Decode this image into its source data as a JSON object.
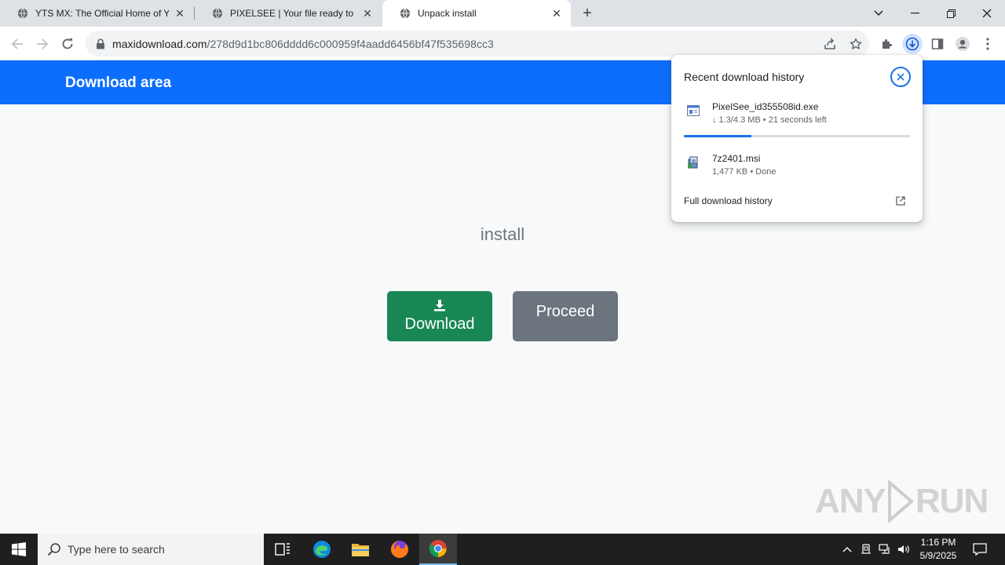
{
  "browser": {
    "tabs": [
      {
        "title": "YTS MX: The Official Home of YIFY",
        "active": false
      },
      {
        "title": "PIXELSEE | Your file ready to download",
        "active": false
      },
      {
        "title": "Unpack install",
        "active": true
      }
    ],
    "new_tab_label": "+",
    "url_host": "maxidownload.com",
    "url_path": "/278d9d1bc806dddd6c000959f4aadd6456bf47f535698cc3"
  },
  "page": {
    "brand": "Download area",
    "install_text": "install",
    "download_button": "Download",
    "proceed_button": "Proceed",
    "watermark": [
      "ANY",
      "RUN"
    ]
  },
  "download_bubble": {
    "title": "Recent download history",
    "items": [
      {
        "name": "PixelSee_id355508id.exe",
        "status": "↓ 1.3/4.3 MB • 21 seconds left",
        "icon": "exe-file-icon",
        "progress": 0.3
      },
      {
        "name": "7z2401.msi",
        "status": "1,477 KB • Done",
        "icon": "msi-installer-icon"
      }
    ],
    "full_history": "Full download history"
  },
  "taskbar": {
    "search_placeholder": "Type here to search",
    "time": "1:16 PM",
    "date": "5/9/2025"
  },
  "colors": {
    "navbar": "#0d6efd",
    "download_button": "#198754",
    "proceed_button": "#6c757d",
    "accent": "#1a73e8"
  }
}
